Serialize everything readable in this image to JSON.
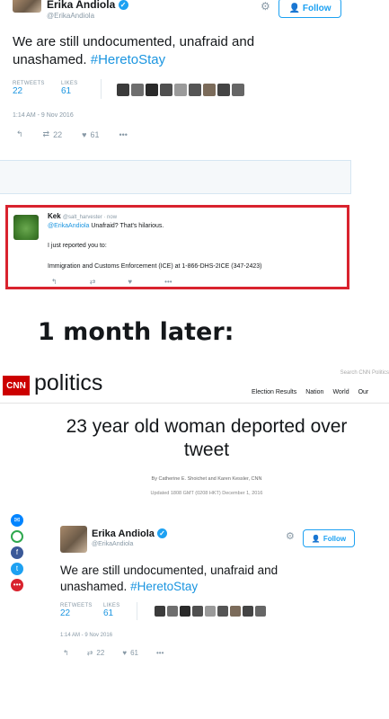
{
  "tweet1": {
    "name": "Erika Andiola",
    "handle": "@ErikaAndiola",
    "follow_label": "Follow",
    "text_plain": "We are still undocumented, unafraid and unashamed. ",
    "hashtag": "#HeretoStay",
    "retweets_label": "RETWEETS",
    "retweets_value": "22",
    "likes_label": "LIKES",
    "likes_value": "61",
    "timestamp": "1:14 AM - 9 Nov 2016",
    "action_retweet_count": "22",
    "action_like_count": "61"
  },
  "reply": {
    "name": "Kek",
    "handle_time": "@salt_harvester · now",
    "mention": "@ErikaAndiola",
    "line1_rest": " Unafraid? That's hilarious.",
    "line2": "I just reported you to:",
    "line3": "Immigration and Customs Enforcement (ICE) at 1-866-DHS-2ICE (347-2423)"
  },
  "caption": "1 month later:",
  "cnn": {
    "logo": "CNN",
    "section": "politics",
    "search_placeholder": "Search CNN Politics",
    "nav": [
      "Election Results",
      "Nation",
      "World",
      "Our"
    ],
    "headline": "23 year old woman deported over tweet",
    "byline": "By Catherine E. Shoichet and Karen Kessler, CNN",
    "updated": "Updated 1808 GMT (0208 HKT) December 1, 2016"
  },
  "tweet2": {
    "name": "Erika Andiola",
    "handle": "@ErikaAndiola",
    "follow_label": "Follow",
    "text_plain": "We are still undocumented, unafraid and unashamed. ",
    "hashtag": "#HeretoStay",
    "retweets_label": "RETWEETS",
    "retweets_value": "22",
    "likes_label": "LIKES",
    "likes_value": "61",
    "timestamp": "1:14 AM - 9 Nov 2016",
    "action_retweet_count": "22",
    "action_like_count": "61"
  },
  "social_icons": [
    "messenger-icon",
    "share-icon",
    "facebook-icon",
    "twitter-icon",
    "more-icon"
  ],
  "colors": {
    "twitter_blue": "#1da1f2",
    "link_blue": "#1b95e0",
    "cnn_red": "#cc0000",
    "reply_border": "#d9232e"
  }
}
